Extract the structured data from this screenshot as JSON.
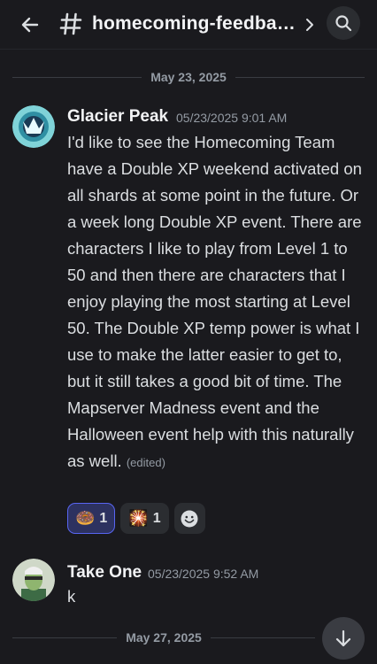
{
  "header": {
    "channel_name": "homecoming-feedba…",
    "back_icon": "arrow-left-icon",
    "hash_icon": "hash-icon",
    "chevron_icon": "chevron-right-icon",
    "search_icon": "search-icon"
  },
  "date_separators": [
    "May 23, 2025",
    "May 27, 2025"
  ],
  "messages": [
    {
      "author": "Glacier Peak",
      "timestamp": "05/23/2025 9:01 AM",
      "text": "I'd like to see the Homecoming Team have a Double XP weekend activated on all shards at some point in the future. Or a week long Double XP event. There are characters I like to play from Level 1 to 50 and then there are characters that I enjoy playing the most starting at Level 50. The Double XP temp power is what I use to make the latter easier to get to, but it still takes a good bit of time. The Mapserver Madness event and the Halloween event help with this naturally as well.",
      "edited_label": "(edited)",
      "reactions": [
        {
          "emoji": "🍩",
          "count": "1",
          "active": true
        },
        {
          "emoji": "🎇",
          "count": "1",
          "active": false
        }
      ]
    },
    {
      "author": "Take One",
      "timestamp": "05/23/2025 9:52 AM",
      "text": "k"
    }
  ],
  "colors": {
    "background": "#1a1a1e",
    "accent": "#5865f2",
    "muted_text": "#949ba4"
  }
}
